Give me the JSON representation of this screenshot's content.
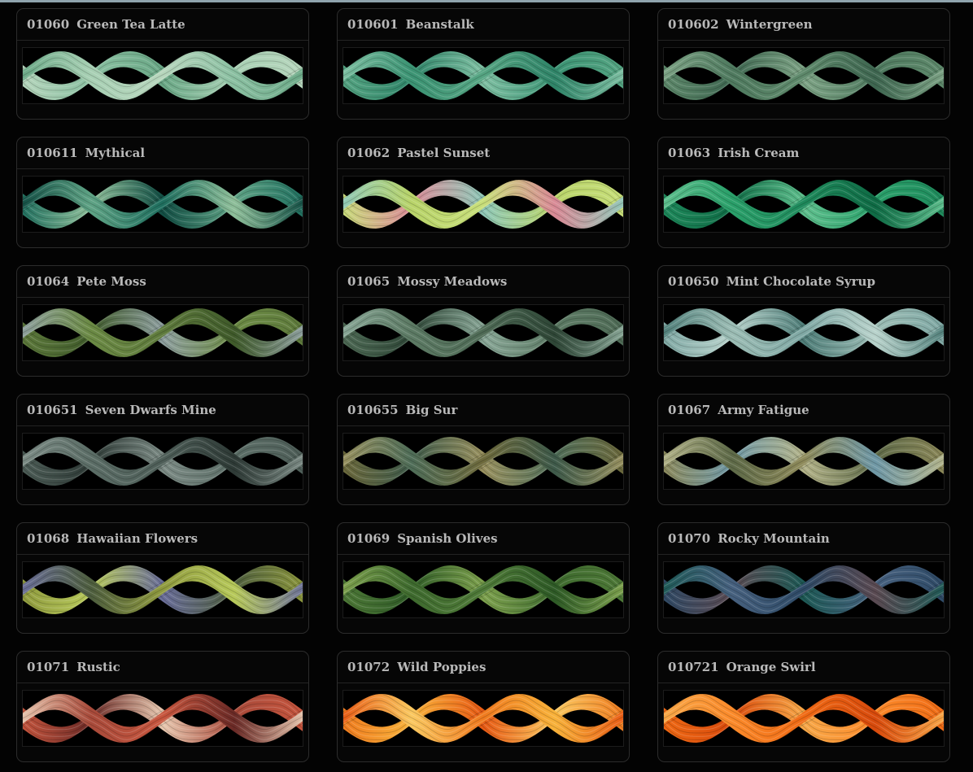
{
  "threads": [
    {
      "number": "01060",
      "name": "Green Tea Latte",
      "colors": [
        "#b7d6bd",
        "#8bc0a2",
        "#6aa886",
        "#a8d0b4"
      ]
    },
    {
      "number": "010601",
      "name": "Beanstalk",
      "colors": [
        "#56a583",
        "#2f8468",
        "#7fc0a3",
        "#3b9373"
      ]
    },
    {
      "number": "010602",
      "name": "Wintergreen",
      "colors": [
        "#5f8a6c",
        "#3e6650",
        "#7ea486",
        "#4f7a5f"
      ]
    },
    {
      "number": "010611",
      "name": "Mythical",
      "colors": [
        "#1e6e5e",
        "#8fbf9a",
        "#124e44",
        "#5fa385"
      ]
    },
    {
      "number": "01062",
      "name": "Pastel Sunset",
      "colors": [
        "#c8df7a",
        "#d98a96",
        "#8fc8b8",
        "#b9d46a"
      ]
    },
    {
      "number": "01063",
      "name": "Irish Cream",
      "colors": [
        "#1f8a5c",
        "#0f6b45",
        "#5fc08e",
        "#2aa06a"
      ]
    },
    {
      "number": "01064",
      "name": "Pete Moss",
      "colors": [
        "#5e7a3c",
        "#3f5a2a",
        "#8fa0a0",
        "#6b8a44"
      ]
    },
    {
      "number": "01065",
      "name": "Mossy Meadows",
      "colors": [
        "#4f6b56",
        "#2e4636",
        "#8aa898",
        "#5c7a64"
      ]
    },
    {
      "number": "010650",
      "name": "Mint Chocolate Syrup",
      "colors": [
        "#7fa8a4",
        "#b9d3cc",
        "#4f7e79",
        "#9cbdb5"
      ]
    },
    {
      "number": "010651",
      "name": "Seven Dwarfs Mine",
      "colors": [
        "#4e5e58",
        "#2e3a36",
        "#7d8c86",
        "#5b6d66"
      ]
    },
    {
      "number": "010655",
      "name": "Big Sur",
      "colors": [
        "#6e6a3c",
        "#3e5a4a",
        "#9a9260",
        "#4f6d58"
      ]
    },
    {
      "number": "01067",
      "name": "Army Fatigue",
      "colors": [
        "#8e8a5a",
        "#6f98a6",
        "#b4b48a",
        "#5e6a48"
      ]
    },
    {
      "number": "01068",
      "name": "Hawaiian Flowers",
      "colors": [
        "#8f9a3e",
        "#b7c95a",
        "#6a6e9a",
        "#4e5e3e"
      ]
    },
    {
      "number": "01069",
      "name": "Spanish Olives",
      "colors": [
        "#4f7a38",
        "#2e5a26",
        "#7ea24e",
        "#3e6a2e"
      ]
    },
    {
      "number": "01070",
      "name": "Rocky Mountain",
      "colors": [
        "#2e4a66",
        "#5a4a52",
        "#1e5a56",
        "#46607e"
      ]
    },
    {
      "number": "01071",
      "name": "Rustic",
      "colors": [
        "#c8563e",
        "#6a2a26",
        "#e8c8b0",
        "#a84a3a"
      ]
    },
    {
      "number": "01072",
      "name": "Wild Poppies",
      "colors": [
        "#f07a1e",
        "#f8b23a",
        "#e85a14",
        "#fac860"
      ]
    },
    {
      "number": "010721",
      "name": "Orange Swirl",
      "colors": [
        "#f06a14",
        "#d84a0c",
        "#f8a848",
        "#fb8a2a"
      ]
    }
  ]
}
